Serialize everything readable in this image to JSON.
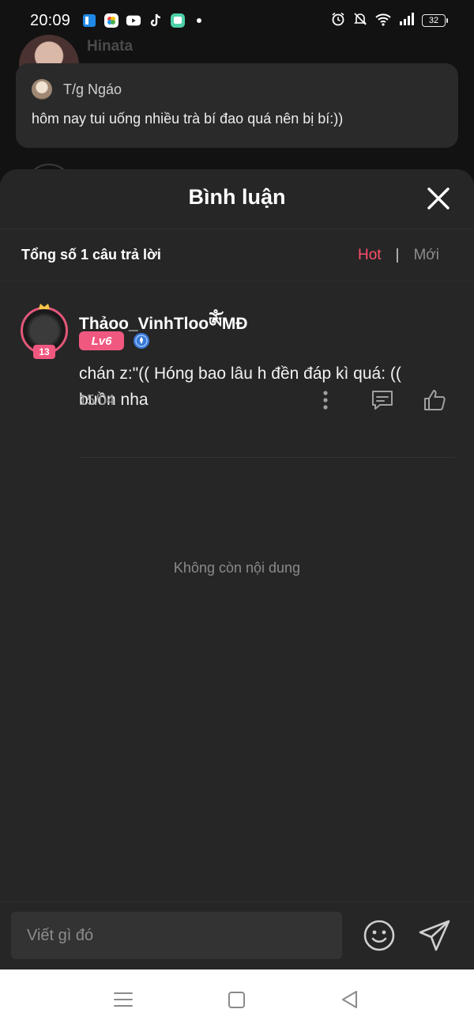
{
  "status_bar": {
    "time": "20:09",
    "battery": "32",
    "app_icons": [
      "notes-app-icon",
      "photos-app-icon",
      "youtube-app-icon",
      "tiktok-app-icon",
      "chat-app-icon"
    ],
    "system_icons": [
      "alarm-icon",
      "mute-icon",
      "wifi-icon",
      "signal-icon",
      "battery-icon"
    ]
  },
  "background_post": {
    "author": "Hinata",
    "quote": {
      "author": "T/g Ngáo",
      "text": "hôm nay tui uống nhiều trà bí đao quá nên bị bí:))"
    }
  },
  "sheet": {
    "title": "Bình luận",
    "summary": "Tổng số 1 câu trả lời",
    "sort": {
      "hot": "Hot",
      "separator": "|",
      "new": "Mới",
      "active": "hot"
    },
    "comments": [
      {
        "name": "Thảoo_VinhTlooༀMĐ",
        "level": "Lv6",
        "avatar_badge": "13",
        "text": "chán z:\"(( Hóng bao lâu h đền đáp kì quá: (( buồn nha",
        "date": "15/04"
      }
    ],
    "end_text": "Không còn nội dung"
  },
  "compose": {
    "placeholder": "Viết gì đó"
  },
  "colors": {
    "accent": "#ff4f6c",
    "level_badge": "#f1587f",
    "sheet_bg": "#262626",
    "card_bg": "#2a2a2a"
  }
}
